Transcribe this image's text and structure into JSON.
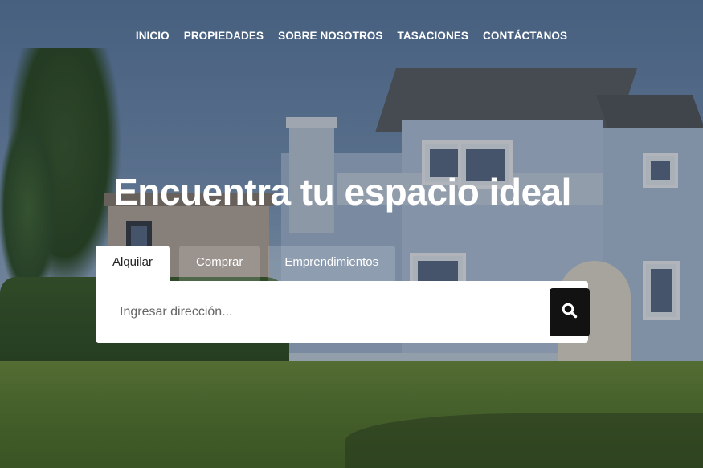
{
  "nav": {
    "items": [
      {
        "label": "INICIO"
      },
      {
        "label": "PROPIEDADES"
      },
      {
        "label": "SOBRE NOSOTROS"
      },
      {
        "label": "TASACIONES"
      },
      {
        "label": "CONTÁCTANOS"
      }
    ]
  },
  "hero": {
    "title": "Encuentra tu espacio ideal"
  },
  "tabs": [
    {
      "label": "Alquilar",
      "active": true
    },
    {
      "label": "Comprar",
      "active": false
    },
    {
      "label": "Emprendimientos",
      "active": false
    }
  ],
  "search": {
    "placeholder": "Ingresar dirección...",
    "value": "",
    "button_icon": "search-icon"
  },
  "colors": {
    "text_light": "#ffffff",
    "button_dark": "#121212",
    "tab_active_bg": "#ffffff"
  }
}
